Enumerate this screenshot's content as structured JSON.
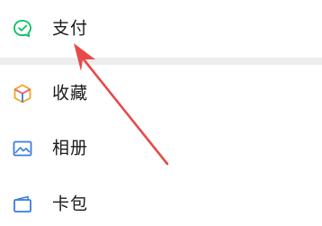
{
  "menu": {
    "items": [
      {
        "label": "支付",
        "icon": "wechat-pay-icon",
        "color": "#07c160"
      },
      {
        "label": "收藏",
        "icon": "favorites-cube-icon",
        "color": "#f5a623"
      },
      {
        "label": "相册",
        "icon": "album-icon",
        "color": "#3b7be0"
      },
      {
        "label": "卡包",
        "icon": "card-wallet-icon",
        "color": "#3b7be0"
      }
    ]
  },
  "annotation": {
    "arrow_color": "#e84a4a"
  }
}
